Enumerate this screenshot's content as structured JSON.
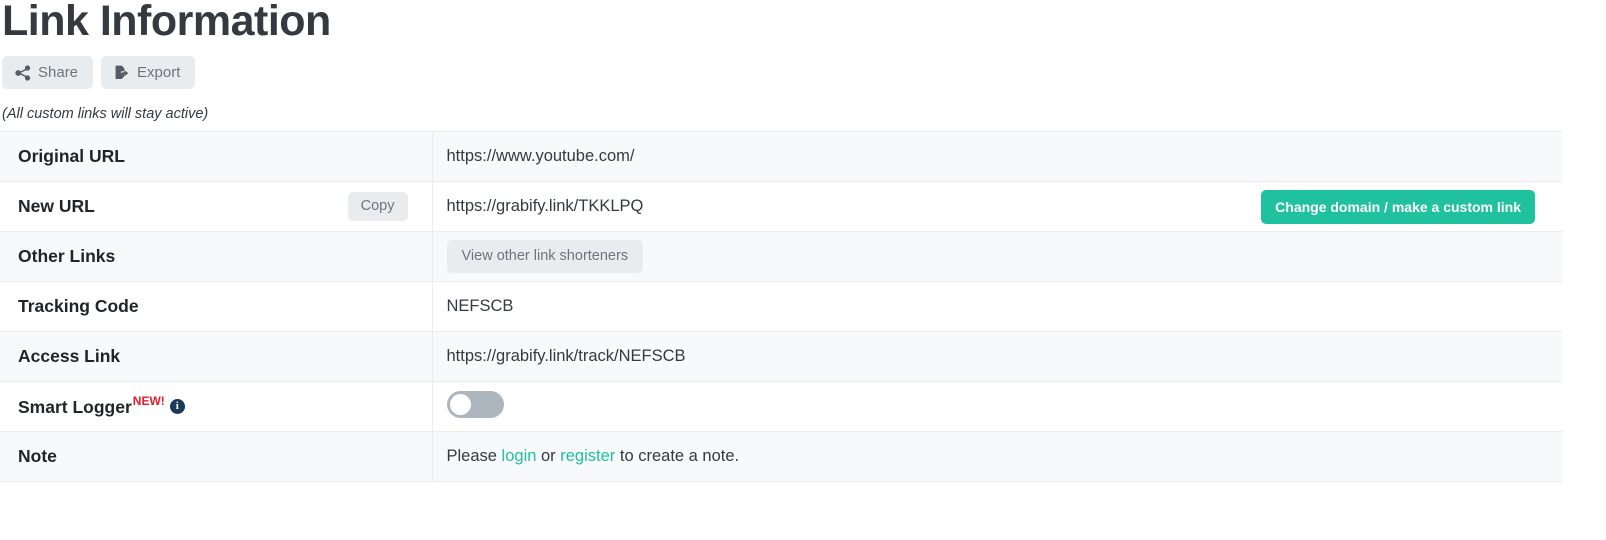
{
  "page": {
    "title": "Link Information",
    "subnote": "(All custom links will stay active)"
  },
  "toolbar": {
    "share_label": "Share",
    "export_label": "Export"
  },
  "table": {
    "rows": [
      {
        "label": "Original URL",
        "value": "https://www.youtube.com/"
      },
      {
        "label": "New URL",
        "copy_label": "Copy",
        "value": "https://grabify.link/TKKLPQ",
        "cta_label": "Change domain / make a custom link"
      },
      {
        "label": "Other Links",
        "button_label": "View other link shorteners"
      },
      {
        "label": "Tracking Code",
        "value": "NEFSCB"
      },
      {
        "label": "Access Link",
        "value": "https://grabify.link/track/NEFSCB"
      },
      {
        "label": "Smart Logger",
        "badge": "NEW!",
        "info_glyph": "i",
        "toggle_state": "off"
      },
      {
        "label": "Note",
        "note_prefix": "Please ",
        "note_login": "login",
        "note_middle": " or ",
        "note_register": "register",
        "note_suffix": " to create a note."
      }
    ]
  },
  "colors": {
    "accent_green": "#20c19e",
    "badge_red": "#e8192c",
    "info_navy": "#1b3a57",
    "stripe": "#f8f9fa",
    "button_grey": "#e9ecef"
  }
}
